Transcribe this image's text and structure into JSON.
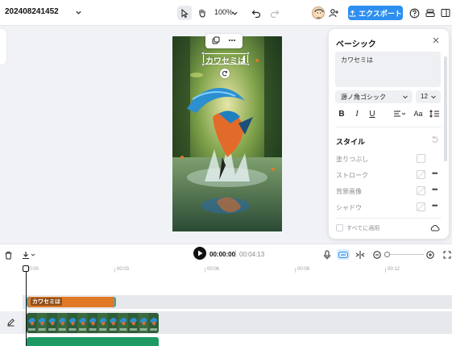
{
  "project": {
    "title": "202408241452"
  },
  "toolbar": {
    "zoom": "100%",
    "export_label": "エクスポート",
    "colors": {
      "export_bg": "#2e8ff0",
      "selected_tool_bg": "#e8eaee"
    }
  },
  "canvas": {
    "text_overlay": "カワセミは",
    "scene_icon_names": [
      "kingfisher-image"
    ]
  },
  "panel": {
    "title": "ベーシック",
    "text_value": "カワセミは",
    "font": "源ノ角ゴシック",
    "font_size": "12",
    "format_buttons": {
      "bold": "B",
      "italic": "I",
      "underline": "U",
      "case": "Aa"
    },
    "style_section_title": "スタイル",
    "style_rows": [
      {
        "label": "塗りつぶし",
        "has_more": false
      },
      {
        "label": "ストローク",
        "has_more": true
      },
      {
        "label": "背景画像",
        "has_more": true
      },
      {
        "label": "シャドウ",
        "has_more": true
      }
    ],
    "more_glyph": "•••",
    "apply_all_label": "すべてに適用"
  },
  "timeline": {
    "current_time": "00:00:00",
    "total_time": "00:04:13",
    "ruler_ticks": [
      "00:00",
      "00:03",
      "00:06",
      "00:09",
      "00:12"
    ],
    "text_clip_label": "カワセミは",
    "colors": {
      "text_clip": "#e07a26",
      "clip_border": "#1fa9c9",
      "audio_clip": "#1d9a63"
    }
  }
}
